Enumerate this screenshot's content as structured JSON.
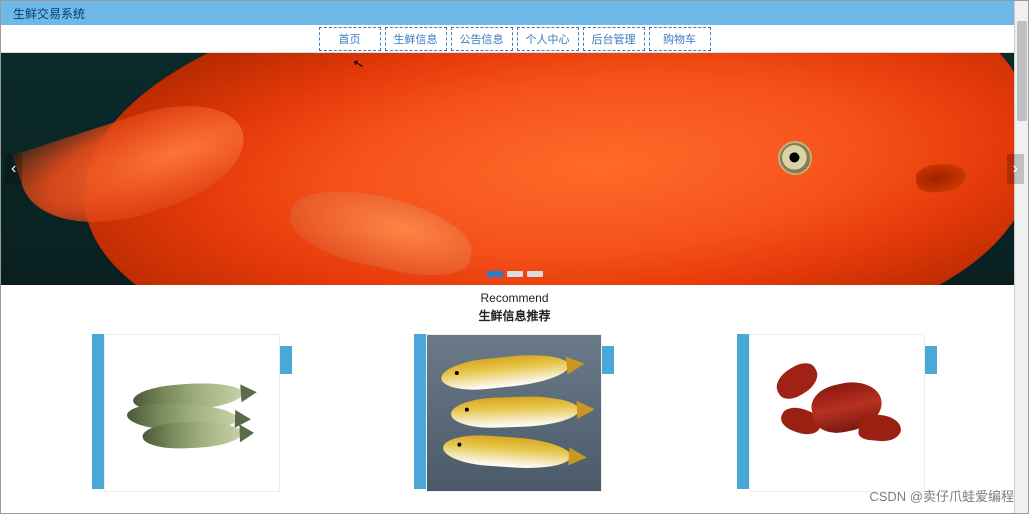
{
  "header": {
    "title": "生鲜交易系统"
  },
  "nav": {
    "items": [
      {
        "label": "首页"
      },
      {
        "label": "生鲜信息"
      },
      {
        "label": "公告信息"
      },
      {
        "label": "个人中心"
      },
      {
        "label": "后台管理"
      },
      {
        "label": "购物车"
      }
    ]
  },
  "banner": {
    "arrow_left": "‹",
    "arrow_right": "›",
    "dot_count": 3,
    "active_dot": 0
  },
  "recommend": {
    "en": "Recommend",
    "cn": "生鲜信息推荐"
  },
  "watermark": "CSDN @卖仔爪蛙爱编程",
  "cursor_glyph": "↖"
}
